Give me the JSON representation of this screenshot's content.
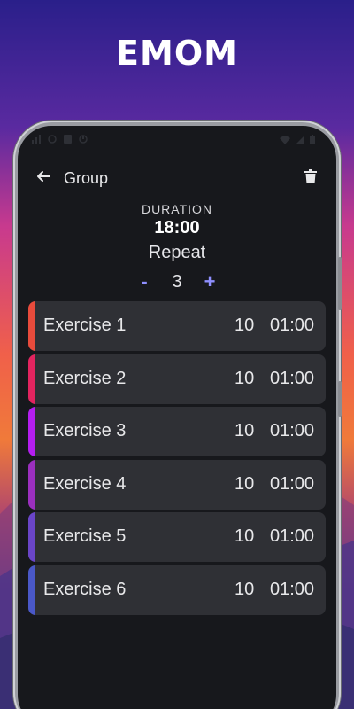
{
  "promo": {
    "headline": "EMOM"
  },
  "header": {
    "title": "Group",
    "back_icon": "arrow-left-icon",
    "delete_icon": "trash-icon"
  },
  "duration": {
    "label": "DURATION",
    "value": "18:00"
  },
  "repeat": {
    "label": "Repeat",
    "decrement": "-",
    "count": "3",
    "increment": "+"
  },
  "exercises": [
    {
      "name": "Exercise 1",
      "reps": "10",
      "time": "01:00",
      "color": "#e84b3c"
    },
    {
      "name": "Exercise 2",
      "reps": "10",
      "time": "01:00",
      "color": "#e3245f"
    },
    {
      "name": "Exercise 3",
      "reps": "10",
      "time": "01:00",
      "color": "#b41ef0"
    },
    {
      "name": "Exercise 4",
      "reps": "10",
      "time": "01:00",
      "color": "#9b2fbf"
    },
    {
      "name": "Exercise 5",
      "reps": "10",
      "time": "01:00",
      "color": "#6a45c8"
    },
    {
      "name": "Exercise 6",
      "reps": "10",
      "time": "01:00",
      "color": "#4a58c8"
    }
  ],
  "colors": {
    "accent": "#8f8fff",
    "card": "#2f3035",
    "background": "#17181c"
  }
}
